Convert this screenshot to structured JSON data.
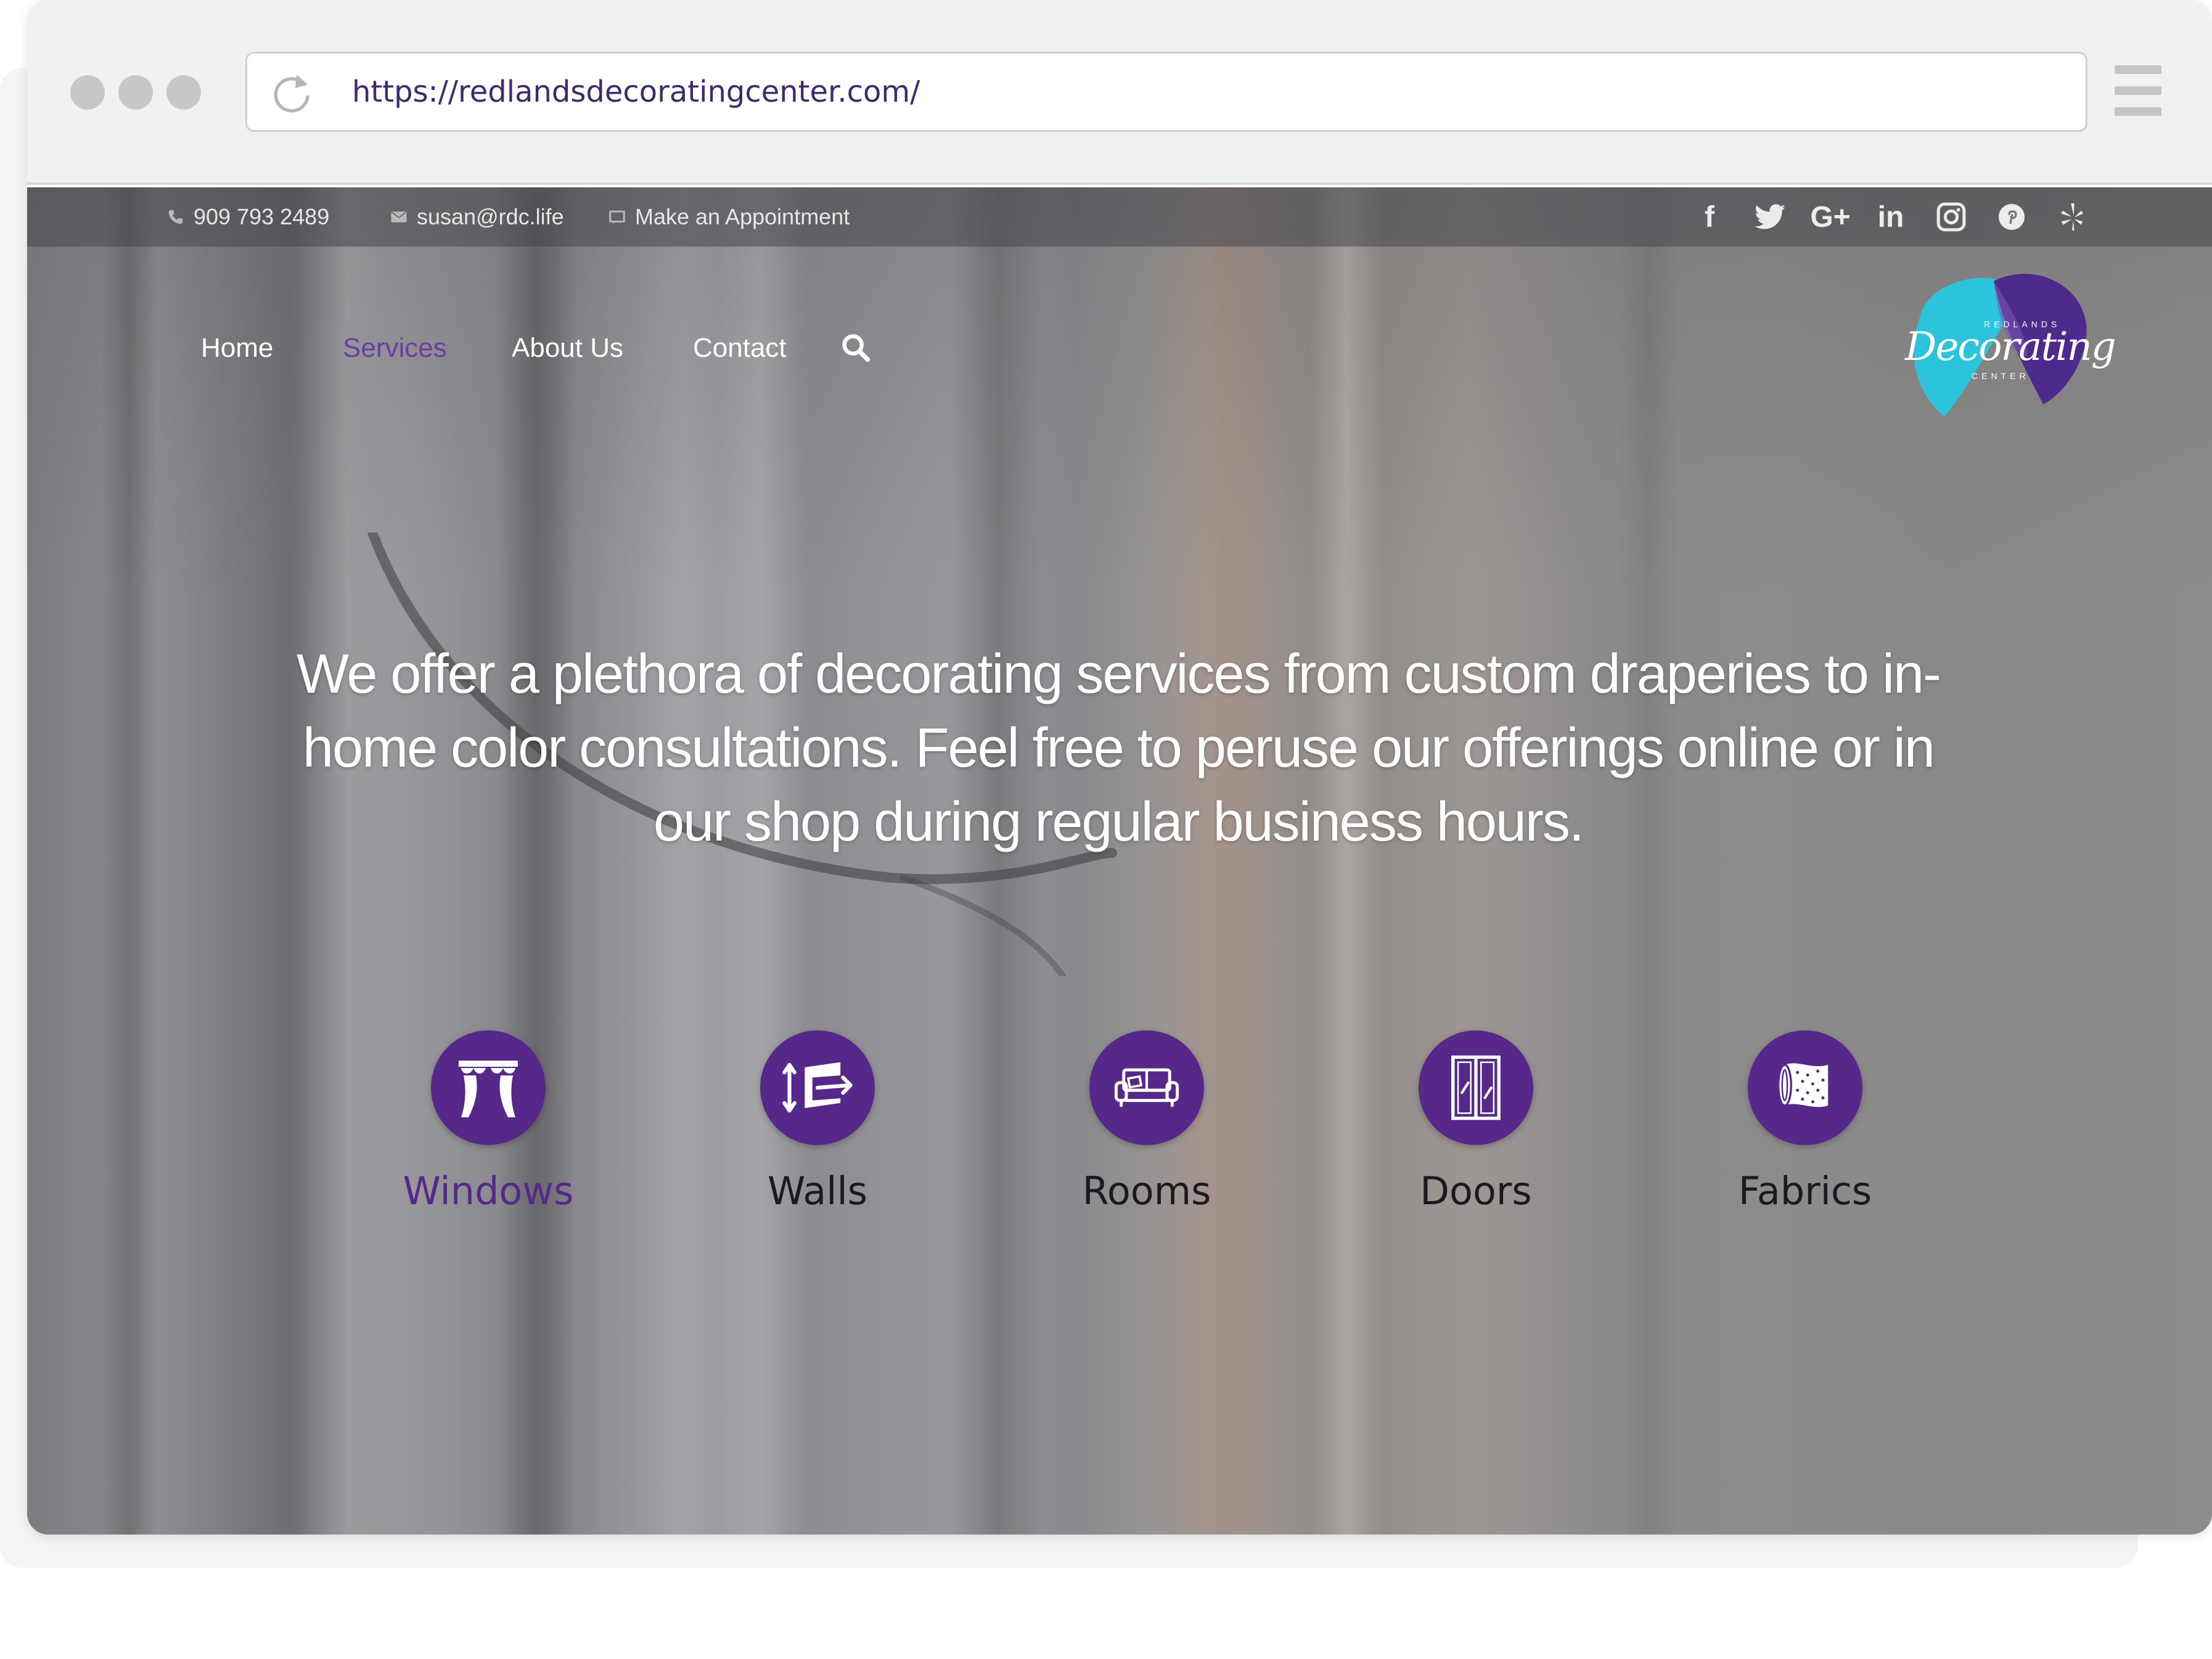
{
  "browser": {
    "url": "https://redlandsdecoratingcenter.com/"
  },
  "topbar": {
    "phone": "909 793 2489",
    "email": "susan@rdc.life",
    "appointment": "Make an Appointment",
    "social": [
      {
        "name": "facebook-icon",
        "glyph": "f"
      },
      {
        "name": "twitter-icon",
        "glyph": "t"
      },
      {
        "name": "google-plus-icon",
        "glyph": "G+"
      },
      {
        "name": "linkedin-icon",
        "glyph": "in"
      },
      {
        "name": "instagram-icon",
        "glyph": "◎"
      },
      {
        "name": "pinterest-icon",
        "glyph": "℗"
      },
      {
        "name": "yelp-icon",
        "glyph": "✽"
      }
    ]
  },
  "nav": {
    "items": [
      "Home",
      "Services",
      "About Us",
      "Contact"
    ],
    "active": "Services"
  },
  "logo": {
    "top_text": "REDLANDS",
    "script_text": "Decorating",
    "bottom_text": "CENTER"
  },
  "hero": {
    "headline": "We offer a plethora of decorating services from custom draperies to in-home color consultations. Feel free to peruse our offerings online or in our shop during regular business hours."
  },
  "services": [
    {
      "label": "Windows",
      "icon": "curtains-icon"
    },
    {
      "label": "Walls",
      "icon": "wallpaper-roll-icon"
    },
    {
      "label": "Rooms",
      "icon": "sofa-icon"
    },
    {
      "label": "Doors",
      "icon": "double-door-icon"
    },
    {
      "label": "Fabrics",
      "icon": "fabric-bolt-icon"
    }
  ],
  "colors": {
    "accent": "#55288a",
    "nav_active": "#6b3fa0",
    "logo_cyan": "#2bc4dc",
    "logo_purple": "#4e2a8c"
  }
}
